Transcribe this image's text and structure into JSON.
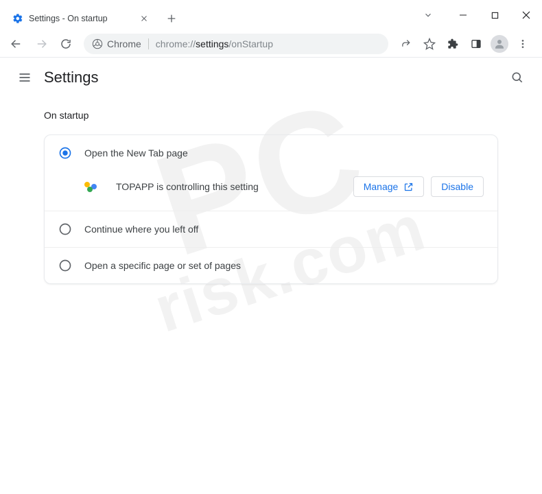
{
  "window": {
    "tab_title": "Settings - On startup",
    "controls": {
      "chevron": "⌵",
      "min": "—",
      "max": "☐",
      "close": "✕"
    }
  },
  "toolbar": {
    "url_scheme": "Chrome",
    "url_prefix": "chrome://",
    "url_bold": "settings",
    "url_suffix": "/onStartup"
  },
  "settings": {
    "header_title": "Settings",
    "section_title": "On startup",
    "options": {
      "opt1": "Open the New Tab page",
      "opt2": "Continue where you left off",
      "opt3": "Open a specific page or set of pages"
    },
    "controlled_msg": "TOPAPP is controlling this setting",
    "manage_label": "Manage",
    "disable_label": "Disable"
  }
}
